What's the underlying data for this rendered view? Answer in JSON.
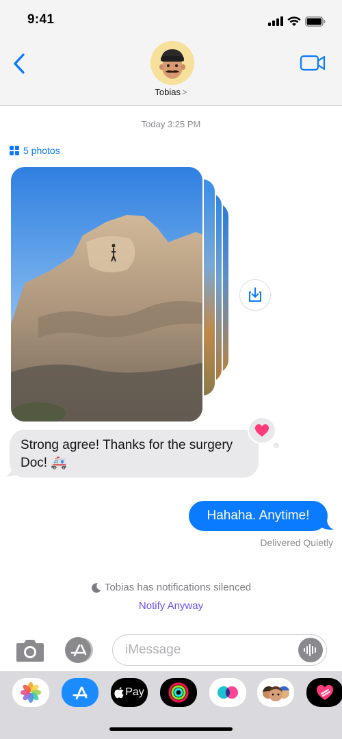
{
  "status_bar": {
    "time": "9:41"
  },
  "header": {
    "contact_name": "Tobias",
    "chevron": ">"
  },
  "conversation": {
    "timestamp": "Today 3:25 PM",
    "photos_label": "5 photos",
    "incoming_message": "Strong agree! Thanks for the surgery Doc! 🚑",
    "tapback": "heart",
    "outgoing_message": "Hahaha. Anytime!",
    "delivery_status": "Delivered Quietly",
    "silenced_notice": "Tobias has notifications silenced",
    "notify_action": "Notify Anyway"
  },
  "input": {
    "placeholder": "iMessage"
  },
  "app_tray": [
    {
      "name": "photos-app",
      "label": ""
    },
    {
      "name": "app-store-app",
      "label": ""
    },
    {
      "name": "apple-pay-app",
      "label": "Pay"
    },
    {
      "name": "activity-app",
      "label": ""
    },
    {
      "name": "digital-touch-app",
      "label": ""
    },
    {
      "name": "memoji-app",
      "label": ""
    },
    {
      "name": "heart-stickers-app",
      "label": ""
    }
  ],
  "colors": {
    "accent": "#0a7aff",
    "incoming_bubble": "#e9e9eb",
    "notify_link": "#6b50ea",
    "tapback_heart": "#ff3b7a"
  }
}
